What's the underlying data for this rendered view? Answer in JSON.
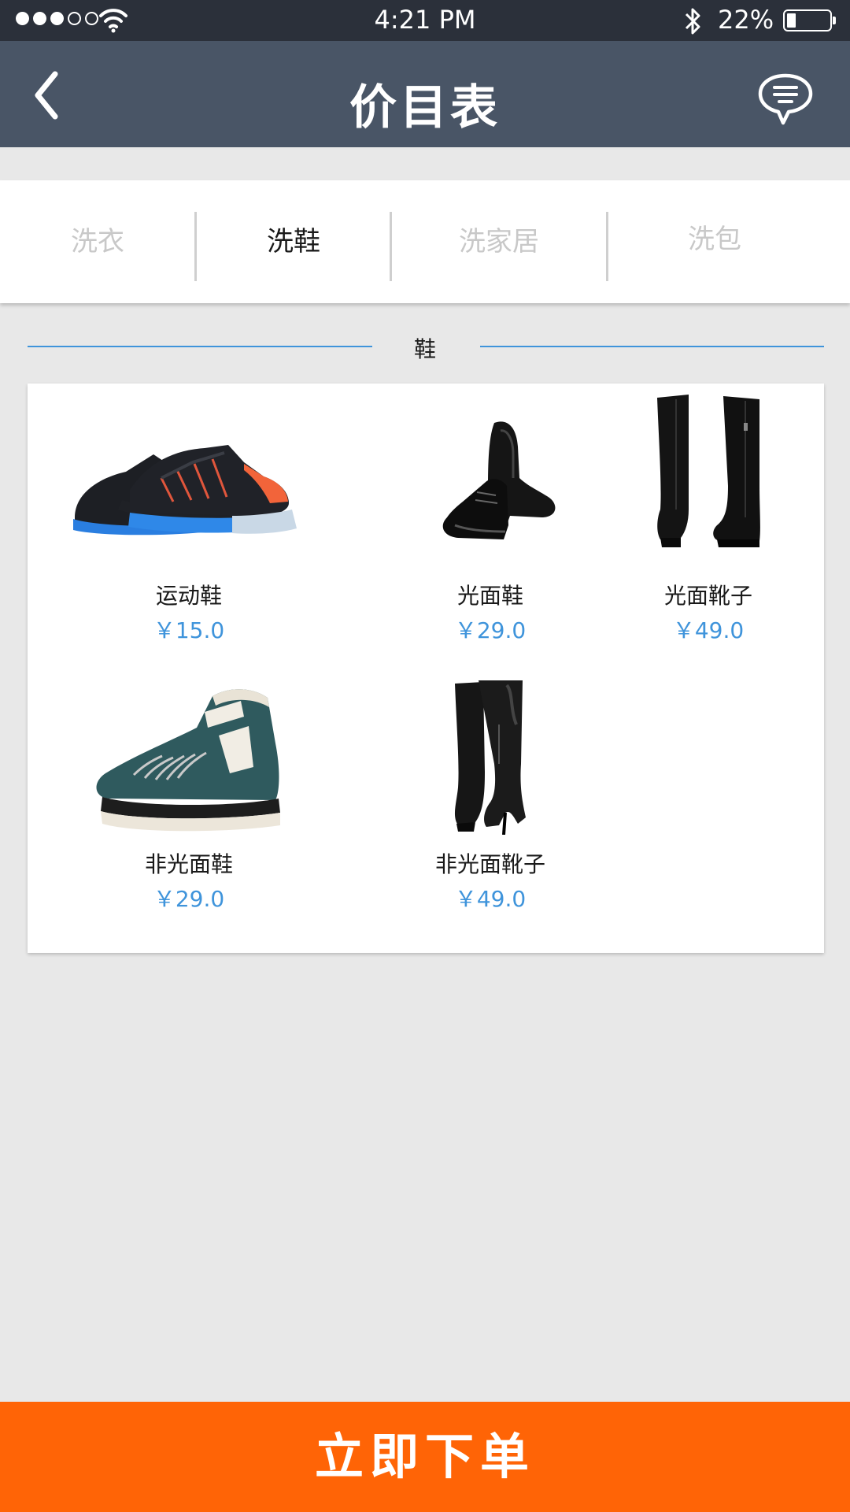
{
  "status_bar": {
    "time": "4:21 PM",
    "battery_percent": "22%",
    "battery_level": 0.22,
    "signal_bars_filled": 3,
    "signal_bars_total": 5,
    "icons": [
      "wifi-icon",
      "bluetooth-icon",
      "battery-icon"
    ]
  },
  "header": {
    "title": "价目表",
    "back_icon": "chevron-left-icon",
    "message_icon": "chat-bubble-icon"
  },
  "tabs": [
    {
      "label": "洗衣",
      "active": false
    },
    {
      "label": "洗鞋",
      "active": true
    },
    {
      "label": "洗家居",
      "active": false
    },
    {
      "label": "洗包",
      "active": false
    }
  ],
  "section": {
    "title": "鞋"
  },
  "products": [
    {
      "name": "运动鞋",
      "price": "￥15.0",
      "image": "sneaker"
    },
    {
      "name": "光面鞋",
      "price": "￥29.0",
      "image": "leather-shoe"
    },
    {
      "name": "光面靴子",
      "price": "￥49.0",
      "image": "leather-boot"
    },
    {
      "name": "非光面鞋",
      "price": "￥29.0",
      "image": "suede-shoe"
    },
    {
      "name": "非光面靴子",
      "price": "￥49.0",
      "image": "suede-boot"
    }
  ],
  "order_button": {
    "label": "立即下单"
  },
  "colors": {
    "status_bar": "#2b303a",
    "header": "#495566",
    "accent_blue": "#3f94db",
    "order_orange": "#ff6406",
    "page_bg": "#e8e8e8"
  }
}
